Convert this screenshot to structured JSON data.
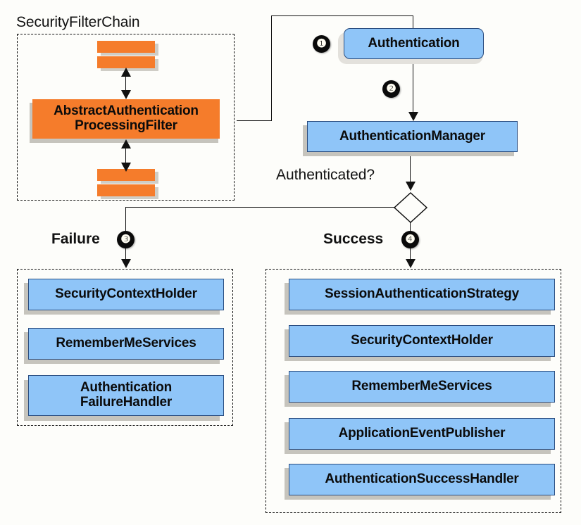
{
  "diagram": {
    "title_filter_chain": "SecurityFilterChain",
    "labels": {
      "authenticated_question": "Authenticated?",
      "failure": "Failure",
      "success": "Success"
    },
    "bullets": {
      "one": "❶",
      "two": "❷",
      "three": "❸",
      "four": "❹"
    },
    "colors": {
      "orange": "#f57c2b",
      "blue": "#8fc5f8",
      "blue_border": "#2a4d80",
      "background": "#fdfdfa",
      "line": "#111111",
      "shadow": "#c6c4bd"
    },
    "filter_chain": {
      "main_filter": "AbstractAuthentication\nProcessingFilter",
      "main_filter_line1": "AbstractAuthentication",
      "main_filter_line2": "ProcessingFilter",
      "upper_strips": 2,
      "lower_strips": 2
    },
    "flow": {
      "authentication": "Authentication",
      "authentication_manager": "AuthenticationManager"
    },
    "failure_branch": {
      "items": [
        {
          "label": "SecurityContextHolder",
          "lines": [
            "SecurityContextHolder"
          ]
        },
        {
          "label": "RememberMeServices",
          "lines": [
            "RememberMeServices"
          ]
        },
        {
          "label": "Authentication FailureHandler",
          "lines": [
            "Authentication",
            "FailureHandler"
          ]
        }
      ]
    },
    "success_branch": {
      "items": [
        {
          "label": "SessionAuthenticationStrategy"
        },
        {
          "label": "SecurityContextHolder"
        },
        {
          "label": "RememberMeServices"
        },
        {
          "label": "ApplicationEventPublisher"
        },
        {
          "label": "AuthenticationSuccessHandler"
        }
      ]
    }
  }
}
